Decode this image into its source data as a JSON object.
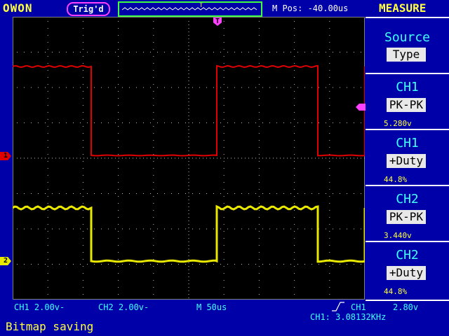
{
  "header": {
    "brand": "OWON",
    "trigger_status": "Trig'd",
    "m_pos": "M Pos: -40.00us",
    "menu_title": "MEASURE"
  },
  "measure_menu": [
    {
      "title": "Source",
      "box": "Type",
      "value": ""
    },
    {
      "title": "CH1",
      "box": "PK-PK",
      "value": "5.280v"
    },
    {
      "title": "CH1",
      "box": "+Duty",
      "value": "44.8%"
    },
    {
      "title": "CH2",
      "box": "PK-PK",
      "value": "3.440v"
    },
    {
      "title": "CH2",
      "box": "+Duty",
      "value": "44.8%"
    }
  ],
  "footer": {
    "ch1_scale": "CH1 2.00v-",
    "ch2_scale": "CH2 2.00v-",
    "timebase": "M  50us",
    "trig_channel": "CH1",
    "trig_level": "2.80v",
    "frequency": "CH1: 3.08132KHz",
    "status": "Bitmap saving"
  },
  "markers": {
    "ch1": "1",
    "ch2": "2",
    "trigger_time": "T"
  },
  "colors": {
    "ch1": "#e00000",
    "ch2": "#e8e800",
    "grid": "#c0c0c0",
    "background": "#0000a8",
    "screen": "#000000"
  }
}
